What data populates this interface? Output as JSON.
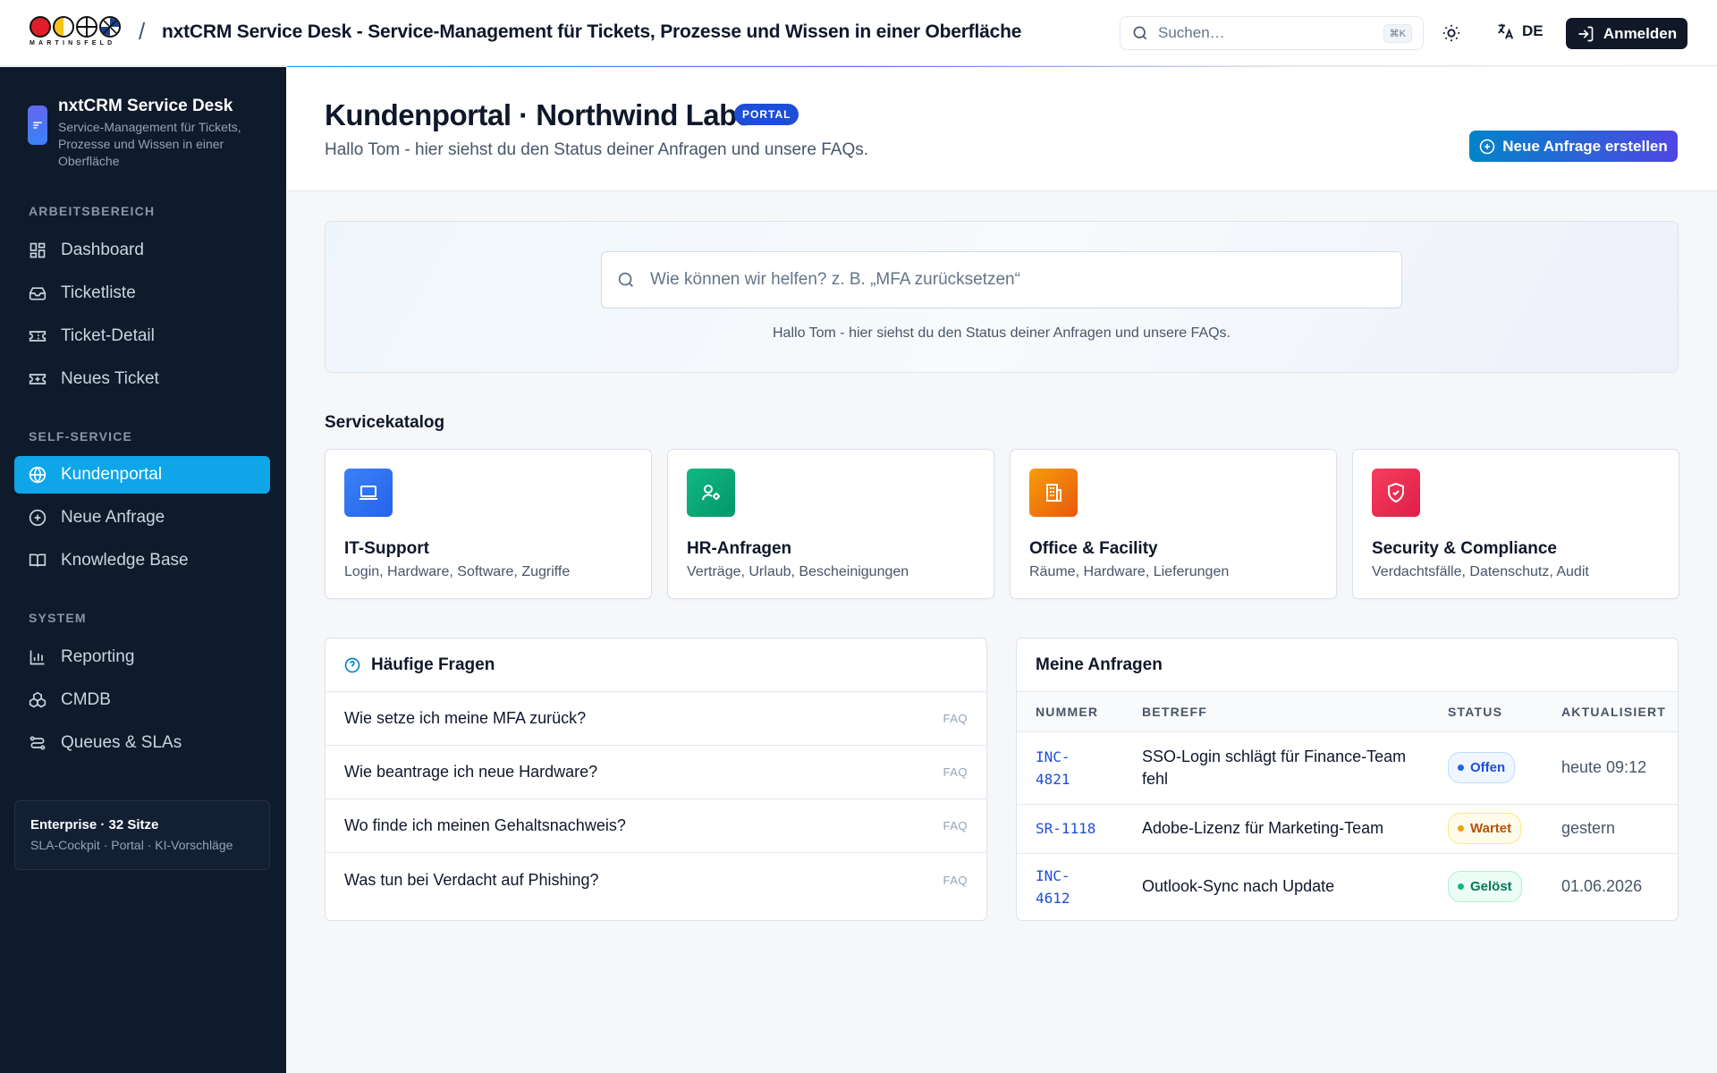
{
  "topbar": {
    "logo_text": "MARTINSFELD",
    "separator": "/",
    "title": "nxtCRM Service Desk - Service-Management für Tickets, Prozesse und Wissen in einer Oberfläche",
    "search_placeholder": "Suchen…",
    "search_shortcut": "⌘K",
    "language": "DE",
    "login_label": "Anmelden"
  },
  "sidebar": {
    "brand_title": "nxtCRM Service Desk",
    "brand_subtitle": "Service-Management für Tickets, Prozesse und Wissen in einer Oberfläche",
    "sections": {
      "workspace": "ARBEITSBEREICH",
      "self_service": "SELF-SERVICE",
      "system": "SYSTEM"
    },
    "items": {
      "dashboard": "Dashboard",
      "ticketliste": "Ticketliste",
      "ticket_detail": "Ticket-Detail",
      "neues_ticket": "Neues Ticket",
      "kundenportal": "Kundenportal",
      "neue_anfrage": "Neue Anfrage",
      "knowledge_base": "Knowledge Base",
      "reporting": "Reporting",
      "cmdb": "CMDB",
      "queues": "Queues & SLAs"
    },
    "active_item": "kundenportal",
    "plan": {
      "title": "Enterprise · 32 Sitze",
      "subtitle": "SLA-Cockpit · Portal · KI-Vorschläge"
    }
  },
  "header": {
    "title": "Kundenportal · Northwind Labs",
    "badge": "PORTAL",
    "subtitle": "Hallo Tom - hier siehst du den Status deiner Anfragen und unsere FAQs.",
    "new_request_label": "Neue Anfrage erstellen"
  },
  "hero": {
    "search_placeholder": "Wie können wir helfen? z. B. „MFA zurücksetzen“",
    "note": "Hallo Tom - hier siehst du den Status deiner Anfragen und unsere FAQs."
  },
  "catalog": {
    "title": "Servicekatalog",
    "cards": [
      {
        "title": "IT-Support",
        "subtitle": "Login, Hardware, Software, Zugriffe",
        "icon": "laptop-icon",
        "color": "#2563eb"
      },
      {
        "title": "HR-Anfragen",
        "subtitle": "Verträge, Urlaub, Bescheinigungen",
        "icon": "user-cog-icon",
        "color": "#059669"
      },
      {
        "title": "Office & Facility",
        "subtitle": "Räume, Hardware, Lieferungen",
        "icon": "building-icon",
        "color": "#f97316"
      },
      {
        "title": "Security & Compliance",
        "subtitle": "Verdachtsfälle, Datenschutz, Audit",
        "icon": "shield-icon",
        "color": "#e11d48"
      }
    ]
  },
  "faq": {
    "title": "Häufige Fragen",
    "items": [
      {
        "question": "Wie setze ich meine MFA zurück?",
        "tag": "FAQ"
      },
      {
        "question": "Wie beantrage ich neue Hardware?",
        "tag": "FAQ"
      },
      {
        "question": "Wo finde ich meinen Gehaltsnachweis?",
        "tag": "FAQ"
      },
      {
        "question": "Was tun bei Verdacht auf Phishing?",
        "tag": "FAQ"
      }
    ]
  },
  "requests": {
    "title": "Meine Anfragen",
    "columns": [
      "NUMMER",
      "BETREFF",
      "STATUS",
      "AKTUALISIERT"
    ],
    "rows": [
      {
        "id_line1": "INC-",
        "id_line2": "4821",
        "subject": "SSO-Login schlägt für Finance-Team fehl",
        "status": "Offen",
        "status_color": "#2563eb",
        "updated": "heute 09:12"
      },
      {
        "id_line1": "SR-1118",
        "id_line2": "",
        "subject": "Adobe-Lizenz für Marketing-Team",
        "status": "Wartet",
        "status_color": "#d97706",
        "updated": "gestern"
      },
      {
        "id_line1": "INC-",
        "id_line2": "4612",
        "subject": "Outlook-Sync nach Update",
        "status": "Gelöst",
        "status_color": "#059669",
        "updated": "01.06.2026"
      }
    ]
  }
}
